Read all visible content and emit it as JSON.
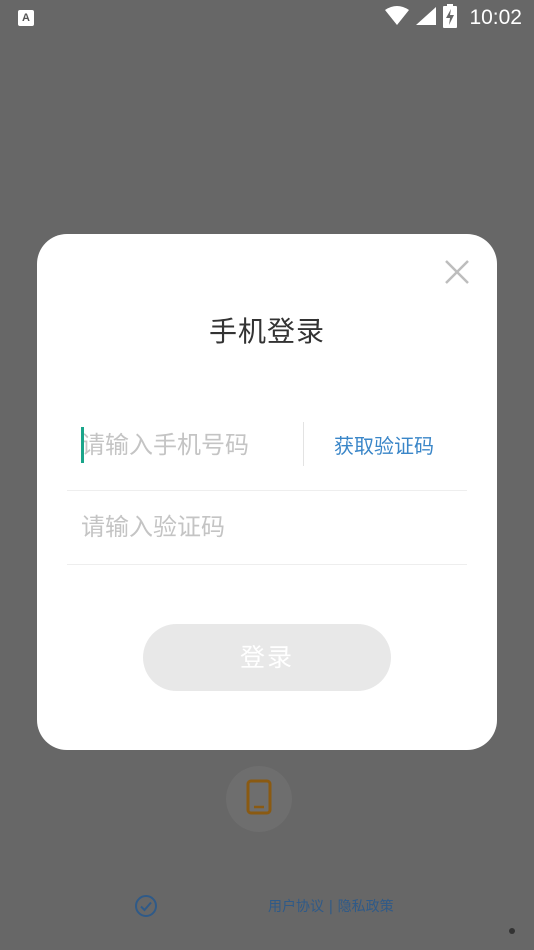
{
  "status_bar": {
    "app_icon_letter": "A",
    "time": "10:02",
    "icons": [
      "wifi-icon",
      "signal-icon",
      "battery-charging-icon"
    ]
  },
  "modal": {
    "title": "手机登录",
    "close_icon": "close-icon",
    "phone": {
      "value": "",
      "placeholder": "请输入手机号码"
    },
    "get_code_label": "获取验证码",
    "code": {
      "value": "",
      "placeholder": "请输入验证码"
    },
    "login_label": "登录"
  },
  "background": {
    "phone_login_icon": "phone-icon",
    "agreement_check_icon": "check-circle-icon",
    "agreement_links": "用户协议 | 隐私政策"
  },
  "colors": {
    "overlay": "#676767",
    "accent": "#3a86c8",
    "caret": "#1aa58a",
    "login_disabled": "#e8e8e8"
  }
}
